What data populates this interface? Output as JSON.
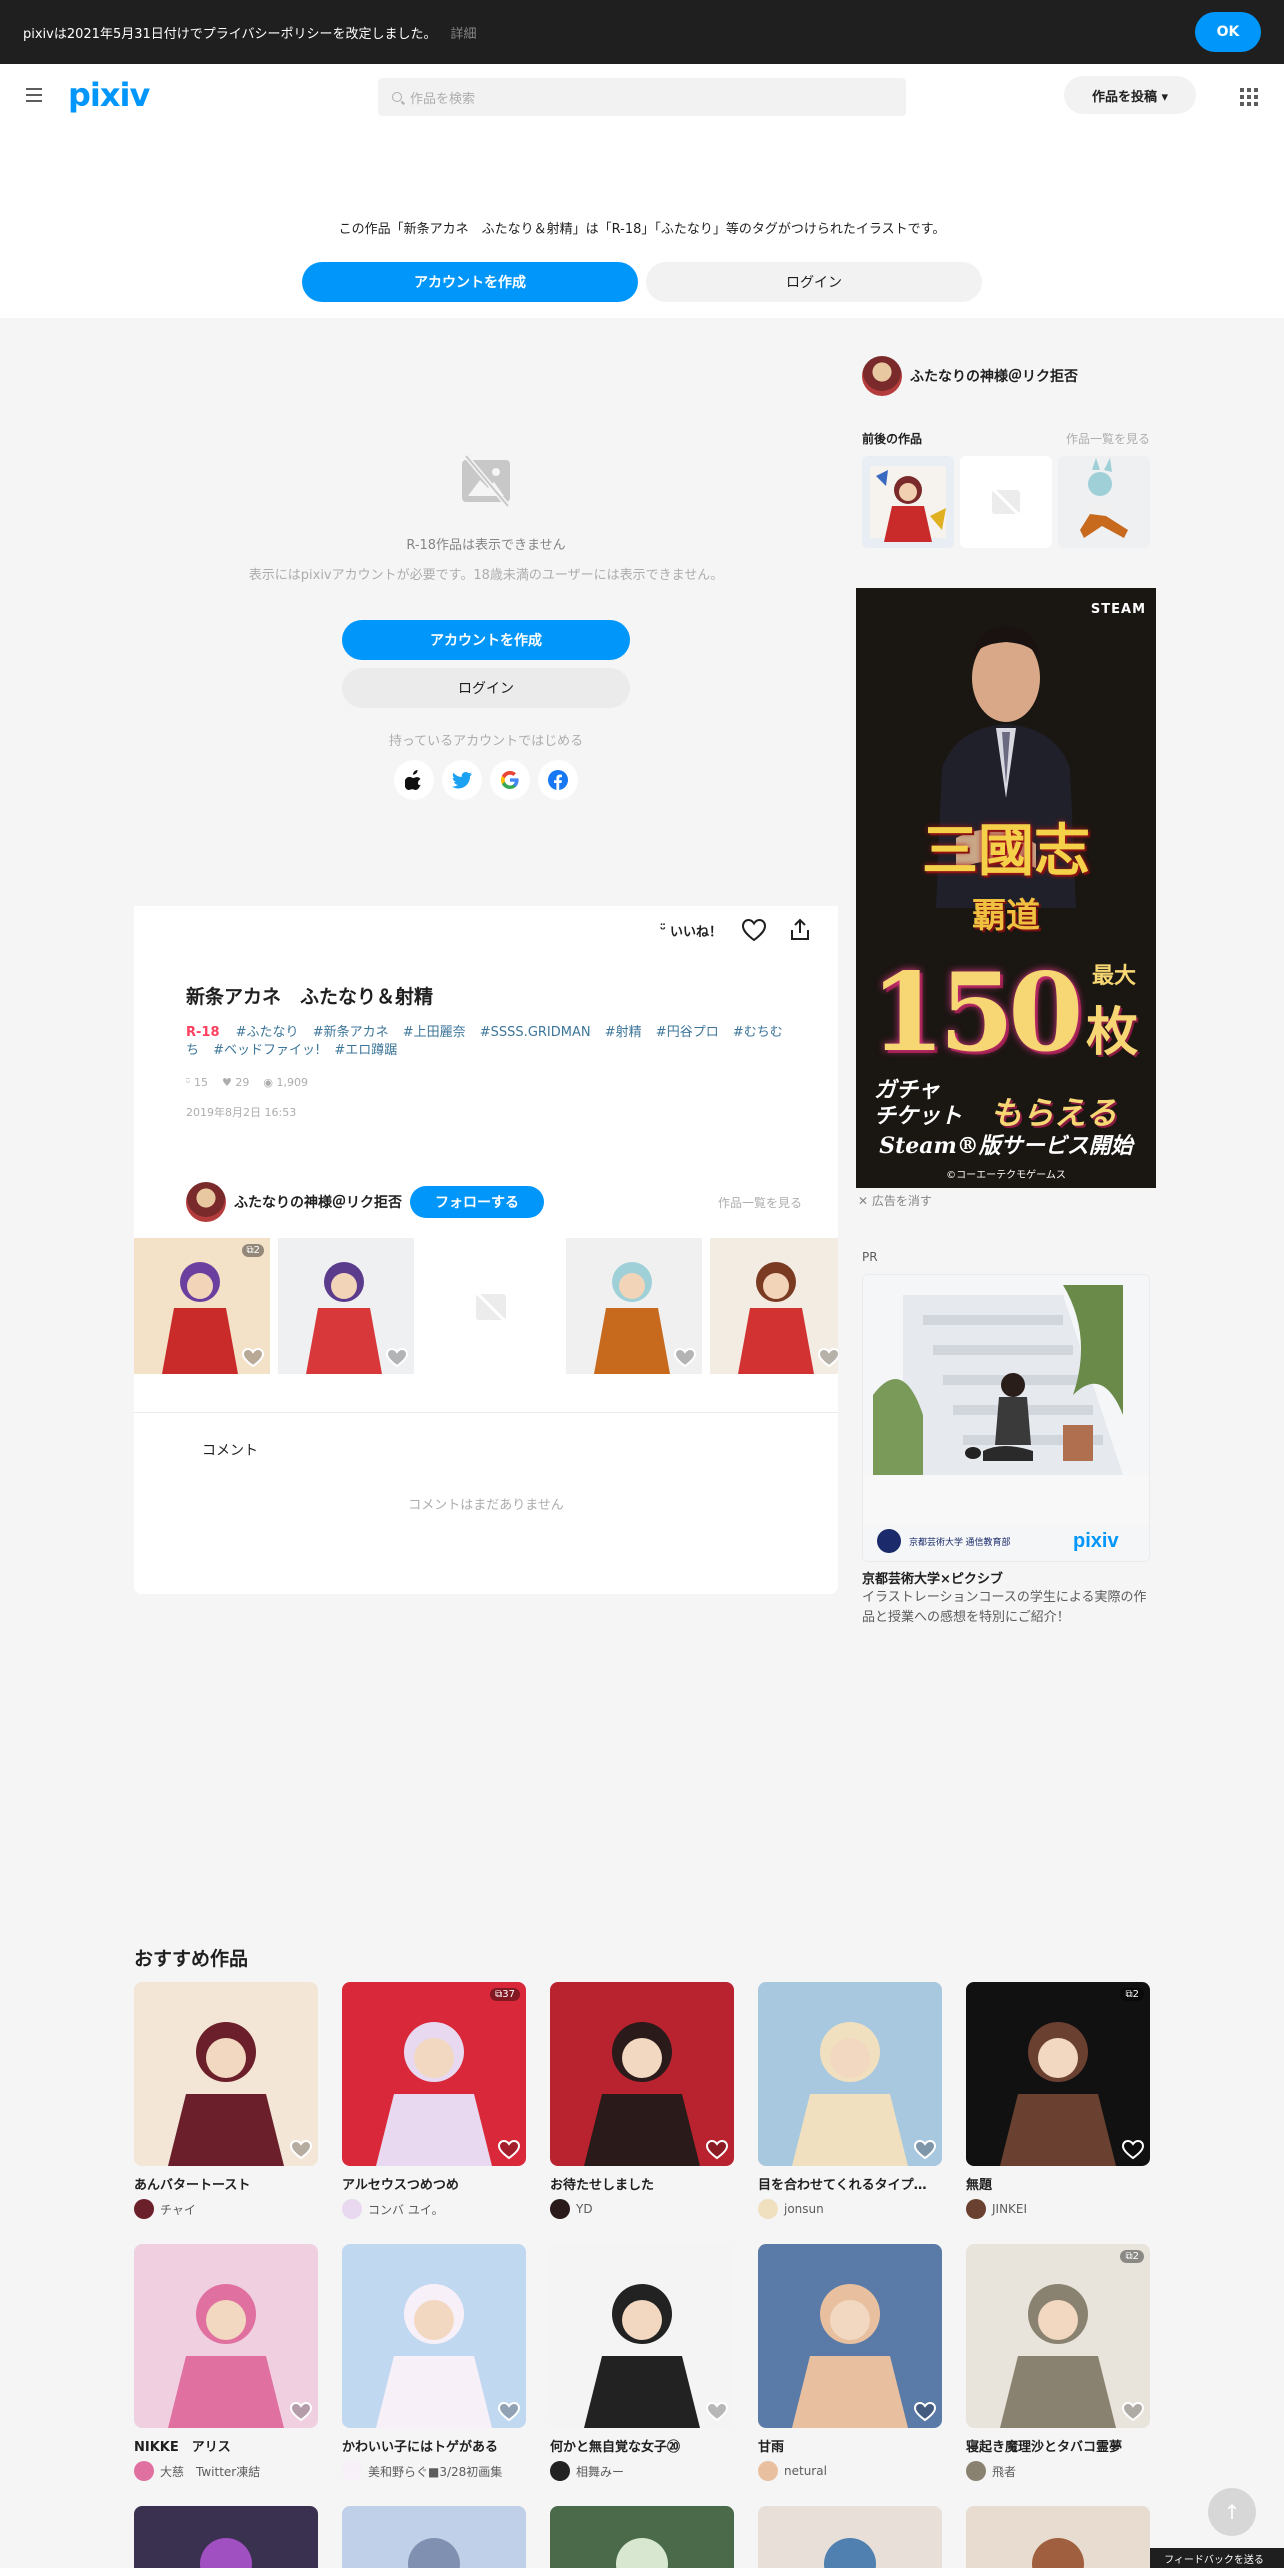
{
  "notice": {
    "text": "pixivは2021年5月31日付けでプライバシーポリシーを改定しました。",
    "more": "詳細",
    "ok": "OK"
  },
  "header": {
    "logo": "pixiv",
    "search_placeholder": "作品を検索",
    "post_button": "作品を投稿 ▾"
  },
  "tag_notice": {
    "message": "この作品「新条アカネ　ふたなり＆射精」は「R-18」「ふたなり」等のタグがつけられたイラストです。",
    "create_account": "アカウントを作成",
    "login": "ログイン"
  },
  "blocked": {
    "title": "R-18作品は表示できません",
    "desc": "表示にはpixivアカウントが必要です。18歳未満のユーザーには表示できません。",
    "create_account": "アカウントを作成",
    "login": "ログイン",
    "start_with": "持っているアカウントではじめる",
    "socials": [
      "apple-icon",
      "twitter-icon",
      "google-icon",
      "facebook-icon"
    ]
  },
  "actions": {
    "like": "いいね！"
  },
  "work": {
    "title": "新条アカネ　ふたなり＆射精",
    "r18": "R-18",
    "tags": [
      "#ふたなり",
      "#新条アカネ",
      "#上田麗奈",
      "#SSSS.GRIDMAN",
      "#射精",
      "#円谷プロ",
      "#むちむち",
      "#ベッドファイッ!",
      "#エロ蹲踞"
    ],
    "likes": "15",
    "bookmarks": "29",
    "views": "1,909",
    "date": "2019年8月2日 16:53"
  },
  "author": {
    "name": "ふたなりの神様＠リク拒否",
    "follow": "フォローする",
    "list_link": "作品一覧を見る"
  },
  "strip": [
    {
      "count": "2",
      "colors": [
        "#c92a2a",
        "#6b3fa0",
        "#f4e2c8"
      ]
    },
    {
      "count": "",
      "colors": [
        "#d9383a",
        "#5a3b8c",
        "#eef0f2"
      ]
    },
    {
      "count": "",
      "colors": []
    },
    {
      "count": "",
      "colors": [
        "#c86a1e",
        "#9fd0d8",
        "#f0f0f0"
      ]
    },
    {
      "count": "",
      "colors": [
        "#d23232",
        "#7a3b22",
        "#f3ece2"
      ]
    }
  ],
  "comments": {
    "header": "コメント",
    "empty": "コメントはまだありません"
  },
  "sidebar": {
    "author": "ふたなりの神様＠リク拒否",
    "prev_next": "前後の作品",
    "list_link": "作品一覧を見る",
    "ad_close": "広告を消す",
    "pr_label": "PR",
    "pr_title": "京都芸術大学×ピクシブ",
    "pr_desc": "イラストレーションコースの学生による実際の作品と授業への感想を特別にご紹介！",
    "pr_brand": "京都芸術大学 通信教育部",
    "pr_logo": "pixiv"
  },
  "ad": {
    "steam": "STEAM",
    "title1": "三國志",
    "title2": "覇道",
    "num": "150",
    "max": "最大",
    "unit": "枚",
    "gacha": "ガチャ\nチケット",
    "morae": "もらえる",
    "svc": "Steam®版サービス開始",
    "copy": "©コーエーテクモゲームス"
  },
  "recommended": {
    "header": "おすすめ作品",
    "items": [
      {
        "title": "あんバタートースト",
        "user": "チャイ",
        "count": "",
        "c1": "#f3e6d6",
        "c2": "#6b1f2a"
      },
      {
        "title": "アルセウスつめつめ",
        "user": "コンバ ユイ。",
        "count": "37",
        "c1": "#d9283a",
        "c2": "#e8d8f0"
      },
      {
        "title": "お待たせしました",
        "user": "YD",
        "count": "",
        "c1": "#b8232f",
        "c2": "#2a1a1a"
      },
      {
        "title": "目を合わせてくれるタイプ…",
        "user": "jonsun",
        "count": "",
        "c1": "#a8c8e0",
        "c2": "#f0e0c0"
      },
      {
        "title": "無題",
        "user": "JINKEI",
        "count": "2",
        "c1": "#111111",
        "c2": "#6a4030"
      },
      {
        "title": "NIKKE　アリス",
        "user": "大慈　Twitter凍結",
        "count": "",
        "c1": "#f0d0e0",
        "c2": "#e070a0"
      },
      {
        "title": "かわいい子にはトゲがある",
        "user": "美和野らぐ■3/28初画集",
        "count": "",
        "c1": "#c0d8f0",
        "c2": "#f8f0f8"
      },
      {
        "title": "何かと無自覚な女子⑳",
        "user": "相舞みー",
        "count": "",
        "c1": "#f4f4f4",
        "c2": "#222222"
      },
      {
        "title": "甘雨",
        "user": "netural",
        "count": "",
        "c1": "#5a7aa8",
        "c2": "#e8c0a0"
      },
      {
        "title": "寝起き魔理沙とタバコ霊夢",
        "user": "飛者",
        "count": "2",
        "c1": "#e8e4dc",
        "c2": "#8a8270"
      }
    ]
  },
  "footer": {
    "feedback": "フィードバックを送る"
  }
}
